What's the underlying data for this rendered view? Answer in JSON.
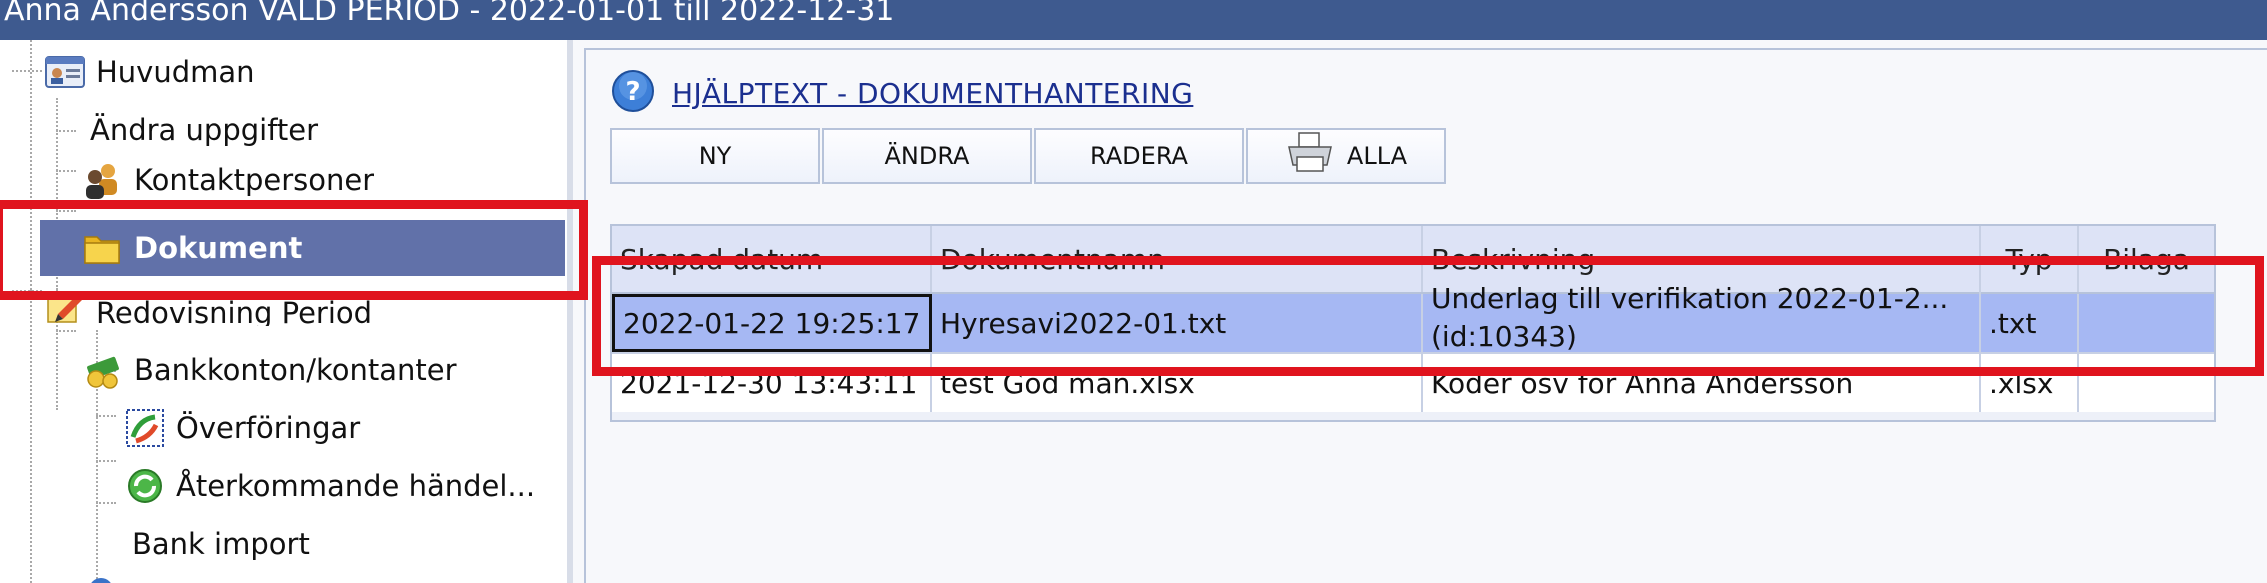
{
  "titlebar": {
    "title": "Anna Andersson  VALD PERIOD - 2022-01-01 till 2022-12-31"
  },
  "tree": {
    "items": [
      {
        "label": "Huvudman",
        "icon": "id-card-icon"
      },
      {
        "label": "Ändra uppgifter",
        "icon": ""
      },
      {
        "label": "Kontaktpersoner",
        "icon": "contacts-icon"
      },
      {
        "label": "Dokument",
        "icon": "folder-icon"
      },
      {
        "label": "Redovisning Period",
        "icon": "pencil-document-icon"
      },
      {
        "label": "Bankkonton/kontanter",
        "icon": "money-icon"
      },
      {
        "label": "Överföringar",
        "icon": "transfer-icon"
      },
      {
        "label": "Återkommande  händel...",
        "icon": "recurring-icon"
      },
      {
        "label": "Bank import",
        "icon": ""
      }
    ]
  },
  "help": {
    "link": "HJÄLPTEXT  -  DOKUMENTHANTERING"
  },
  "toolbar": {
    "new_label": "NY",
    "edit_label": "ÄNDRA",
    "delete_label": "RADERA",
    "all_label": "ALLA"
  },
  "grid": {
    "columns": [
      "Skapad datum",
      "Dokumentnamn",
      "Beskrivning",
      "Typ",
      "Bilaga"
    ],
    "rows": [
      {
        "created": "2022-01-22 19:25:17",
        "name": "Hyresavi2022-01.txt",
        "description": "Underlag till verifikation 2022-01-2... (id:10343)",
        "type": ".txt",
        "attachment": ""
      },
      {
        "created": "2021-12-30 13:43:11",
        "name": "test God man.xlsx",
        "description": "Koder osv för Anna Andersson",
        "type": ".xlsx",
        "attachment": ""
      }
    ]
  },
  "colors": {
    "titlebar": "#3e5a8f",
    "selected_tree": "#6171a9",
    "selected_row": "#a6b8f3",
    "annotation": "#e0141e"
  }
}
